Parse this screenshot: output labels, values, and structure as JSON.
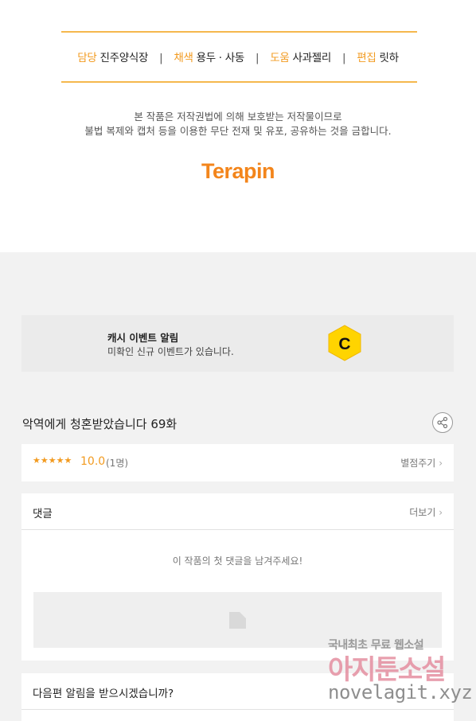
{
  "credits": {
    "items": [
      {
        "role": "담당",
        "name": "진주양식장"
      },
      {
        "role": "채색",
        "name": "용두 · 사동"
      },
      {
        "role": "도움",
        "name": "사과젤리"
      },
      {
        "role": "편집",
        "name": "릿하"
      }
    ],
    "separator": "|",
    "copyright_line1": "본 작품은 저작권법에 의해 보호받는 저작물이므로",
    "copyright_line2": "불법 복제와 캡처 등을 이용한 무단 전재 및 유포, 공유하는 것을 금합니다.",
    "brand": "Terapin",
    "accent_color": "#f29a1f"
  },
  "cash_event": {
    "title": "캐시 이벤트 알림",
    "description": "미확인 신규 이벤트가 있습니다.",
    "icon_letter": "C",
    "icon_color": "#ffd400"
  },
  "episode": {
    "title": "악역에게 청혼받았습니다 69화"
  },
  "rating": {
    "stars": "★★★★★",
    "score": "10.0",
    "count": "(1명)",
    "rate_link": "별점주기"
  },
  "comments": {
    "label": "댓글",
    "more_link": "더보기",
    "empty_message": "이 작품의 첫 댓글을 남겨주세요!"
  },
  "notify": {
    "label": "다음편 알림을 받으시겠습니까?"
  },
  "watermark": {
    "top": "국내최초 무료 웹소설",
    "middle": "아지툰소설",
    "bottom": "novelagit.xyz"
  }
}
